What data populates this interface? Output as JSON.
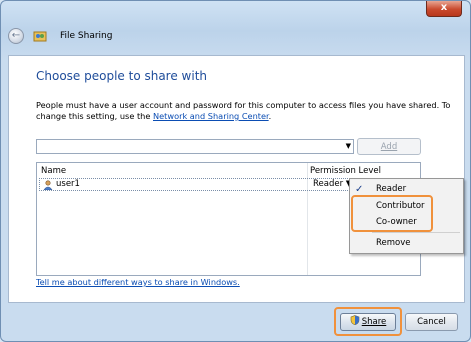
{
  "window": {
    "title": "File Sharing",
    "close_glyph": "x"
  },
  "content": {
    "heading": "Choose people to share with",
    "description_part1": "People must have a user account and password for this computer to access files you have shared.  To change this setting, use the ",
    "description_link": "Network and Sharing Center",
    "description_part2": ".",
    "combo_value": "",
    "add_button": "Add",
    "columns": {
      "name": "Name",
      "permission": "Permission Level"
    },
    "rows": [
      {
        "name": "user1",
        "permission": "Reader"
      }
    ],
    "help_link": "Tell me about different ways to share in Windows."
  },
  "permission_menu": {
    "items": [
      "Reader",
      "Contributor",
      "Co-owner",
      "Remove"
    ],
    "checked": "Reader"
  },
  "buttons": {
    "share": "Share",
    "cancel": "Cancel"
  },
  "colors": {
    "highlight": "#f0913c",
    "heading": "#1e4c9a",
    "link": "#0b4db3"
  },
  "icons": {
    "back": "back-arrow-icon",
    "app": "file-sharing-icon",
    "user": "user-icon",
    "share": "shield-icon",
    "check": "checkmark-icon"
  }
}
